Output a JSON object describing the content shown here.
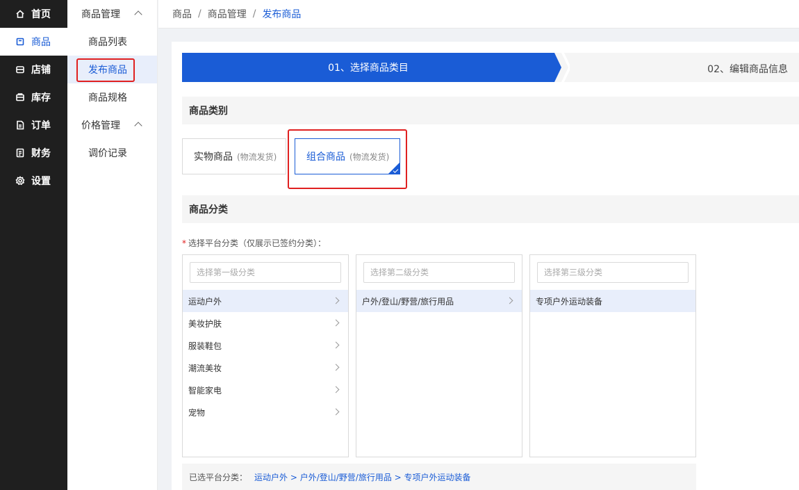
{
  "nav": {
    "items": [
      {
        "label": "首页",
        "icon": "home-icon"
      },
      {
        "label": "商品",
        "icon": "product-icon"
      },
      {
        "label": "店铺",
        "icon": "store-icon"
      },
      {
        "label": "库存",
        "icon": "inventory-icon"
      },
      {
        "label": "订单",
        "icon": "order-icon"
      },
      {
        "label": "财务",
        "icon": "finance-icon"
      },
      {
        "label": "设置",
        "icon": "settings-icon"
      }
    ],
    "active": "商品"
  },
  "submenu": {
    "group1": "商品管理",
    "items1": [
      "商品列表",
      "发布商品",
      "商品规格"
    ],
    "group2": "价格管理",
    "items2": [
      "调价记录"
    ],
    "active": "发布商品"
  },
  "breadcrumb": {
    "items": [
      "商品",
      "商品管理",
      "发布商品"
    ],
    "separator": "/"
  },
  "steps": {
    "step1": "01、选择商品类目",
    "step2": "02、编辑商品信息"
  },
  "product_type": {
    "heading": "商品类别",
    "options": [
      {
        "label": "实物商品",
        "note": "(物流发货)",
        "selected": false
      },
      {
        "label": "组合商品",
        "note": "(物流发货)",
        "selected": true
      }
    ]
  },
  "category": {
    "heading": "商品分类",
    "required_label": "选择平台分类（仅展示已签约分类）：",
    "columns": [
      {
        "placeholder": "选择第一级分类",
        "items": [
          "运动户外",
          "美妆护肤",
          "服装鞋包",
          "潮流美妆",
          "智能家电",
          "宠物"
        ],
        "selected": "运动户外"
      },
      {
        "placeholder": "选择第二级分类",
        "items": [
          "户外/登山/野营/旅行用品"
        ],
        "selected": "户外/登山/野营/旅行用品"
      },
      {
        "placeholder": "选择第三级分类",
        "items": [
          "专项户外运动装备"
        ],
        "selected": "专项户外运动装备"
      }
    ],
    "chosen_label": "已选平台分类：",
    "chosen_path": "运动户外 >  户外/登山/野营/旅行用品 >  专项户外运动装备"
  },
  "colors": {
    "primary": "#1a5cd6",
    "nav_bg": "#1f1f1f",
    "highlight": "#e02020"
  }
}
